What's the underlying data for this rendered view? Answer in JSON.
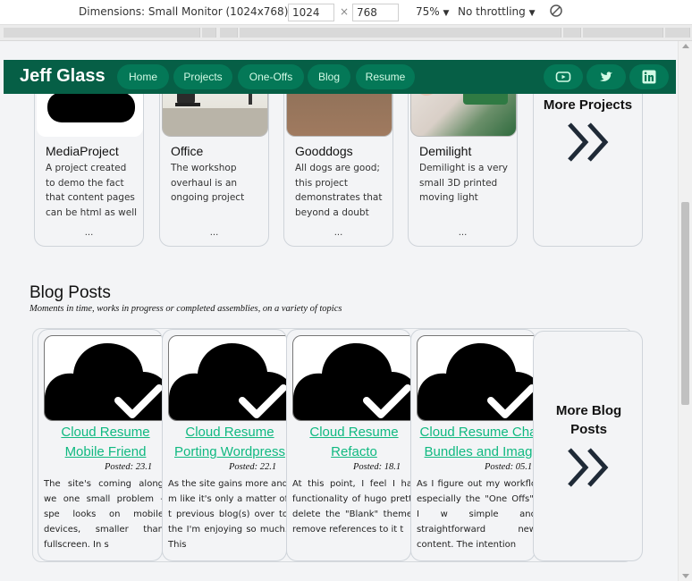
{
  "devtools": {
    "dimensions_label": "Dimensions: Small Monitor (1024x768)",
    "width_value": "1024",
    "times": "×",
    "height_value": "768",
    "zoom": "75%",
    "throttling": "No throttling"
  },
  "navbar": {
    "brand": "Jeff Glass",
    "links": [
      "Home",
      "Projects",
      "One-Offs",
      "Blog",
      "Resume"
    ],
    "social_icons": [
      "youtube-icon",
      "twitter-icon",
      "linkedin-icon"
    ],
    "colors": {
      "bar": "#065f46",
      "pill": "#047857",
      "accent": "#10b981"
    }
  },
  "projects": [
    {
      "title": "MediaProject",
      "desc": "A project created to demo the fact that content pages can be html as well",
      "more": "..."
    },
    {
      "title": "Office",
      "desc": "The workshop overhaul is an ongoing project",
      "more": "..."
    },
    {
      "title": "Gooddogs",
      "desc": "All dogs are good; this project demonstrates that beyond a doubt",
      "more": "..."
    },
    {
      "title": "Demilight",
      "desc": "Demilight is a very small 3D printed moving light",
      "more": "..."
    }
  ],
  "more_projects": "More Projects",
  "blog": {
    "title": "Blog Posts",
    "subtitle": "Moments in time, works in progress or completed assemblies, on a variety of topics",
    "posts": [
      {
        "title_line1": "Cloud Resume",
        "title_line2": "Mobile Friend",
        "posted": "Posted: 23.1",
        "body": "The site's coming along we one small problem - spe looks on mobile devices, smaller than fullscreen. In s"
      },
      {
        "title_line1": "Cloud Resume",
        "title_line2": "Porting Wordpress",
        "posted": "Posted: 22.1",
        "body": "As the site gains more and m like it's only a matter of t previous blog(s) over to the I'm enjoying so much. This"
      },
      {
        "title_line1": "Cloud Resume",
        "title_line2": "Refacto",
        "posted": "Posted: 18.1",
        "body": "At this point, I feel I ha functionality of hugo prett delete the \"Blank\" theme remove references to it t"
      },
      {
        "title_line1": "Cloud Resume Cha",
        "title_line2": "Bundles and Imag",
        "posted": "Posted: 05.1",
        "body": "As I figure out my workflo especially the \"One Offs\", I w simple and straightforward new content. The intention"
      }
    ],
    "more_label": "More Blog Posts"
  }
}
